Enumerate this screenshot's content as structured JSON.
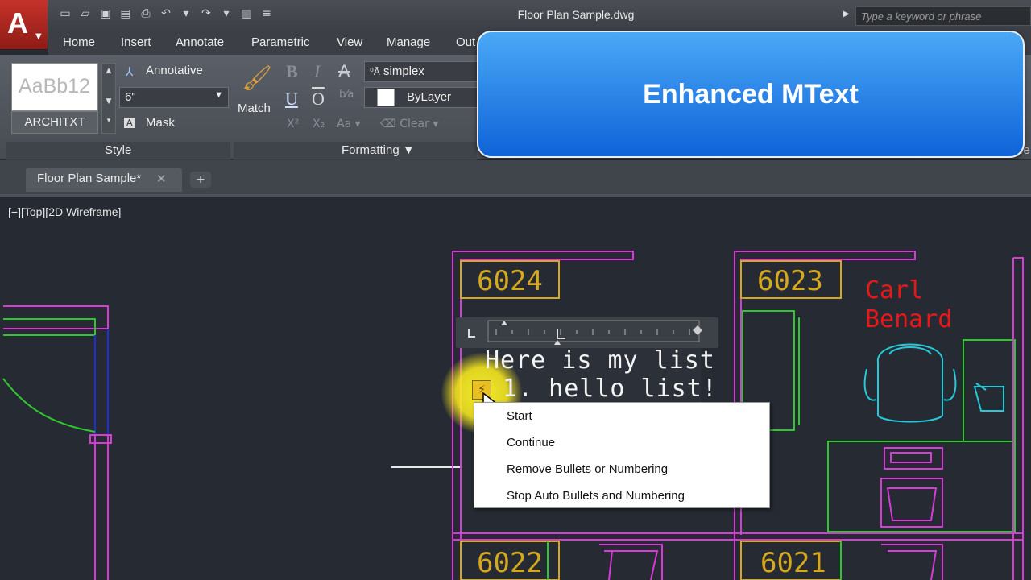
{
  "window": {
    "app_logo": "A",
    "title": "Floor Plan Sample.dwg",
    "search_placeholder": "Type a keyword or phrase"
  },
  "ribbon_tabs": [
    "Home",
    "Insert",
    "Annotate",
    "Parametric",
    "View",
    "Manage",
    "Out"
  ],
  "ribbon": {
    "style_preview_text": "AaBb12",
    "style_name": "ARCHITXT",
    "annotative_label": "Annotative",
    "height_value": "6\"",
    "mask_label": "Mask",
    "style_panel_label": "Style",
    "match_label": "Match",
    "bold_label": "B",
    "italic_label": "I",
    "strike_label": "A",
    "underline_label": "U",
    "overline_label": "O",
    "superscript_label": "X²",
    "subscript_label": "X₂",
    "case_label": "Aa",
    "clear_label": "Clear",
    "font_value": "simplex",
    "color_value": "ByLayer",
    "formatting_panel_label": "Formatting",
    "right_edge_text": "pe"
  },
  "callout": {
    "text": "Enhanced MText"
  },
  "document_tabs": [
    {
      "label": "Floor Plan Sample*",
      "close": "✕"
    }
  ],
  "new_tab_label": "+",
  "viewport_label": "[−][Top][2D Wireframe]",
  "drawing": {
    "room_labels": [
      "6024",
      "6023",
      "6022",
      "6021"
    ],
    "name_label": [
      "Carl",
      "Benard"
    ],
    "colors": {
      "magenta": "#d83ad8",
      "yellow": "#d6a81e",
      "green": "#2ec82e",
      "cyan": "#27c8d8",
      "red": "#e81818",
      "blue": "#2030d0"
    }
  },
  "mtext": {
    "line1": "Here is my list",
    "line2": "1.   hello list!"
  },
  "context_menu": {
    "items": [
      "Start",
      "Continue",
      "Remove Bullets or Numbering",
      "Stop Auto Bullets and Numbering"
    ]
  }
}
